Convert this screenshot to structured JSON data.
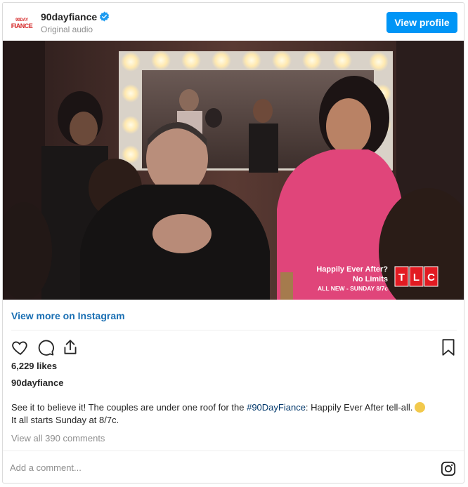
{
  "header": {
    "avatar_line1": "90DAY",
    "avatar_line2": "FIANCE",
    "username": "90dayfiance",
    "subtitle": "Original audio",
    "view_profile_label": "View profile"
  },
  "media": {
    "overlay_line1": "Happily Ever After?",
    "overlay_line2": "No Limits",
    "overlay_line3": "ALL NEW - SUNDAY 8/7c",
    "network_logo": "TLC"
  },
  "view_more_label": "View more on Instagram",
  "icons": {
    "like": "heart-icon",
    "comment": "comment-icon",
    "share": "share-icon",
    "save": "bookmark-icon",
    "instagram": "instagram-icon"
  },
  "likes_text": "6,229 likes",
  "owner_username": "90dayfiance",
  "caption": {
    "before_tag": "See it to believe it! The couples are under one roof for the ",
    "hashtag": "#90DayFiance",
    "after_tag": ": Happily Ever After tell-all.",
    "line2": "It all starts Sunday at 8/7c."
  },
  "comments_link": "View all 390 comments",
  "comment_input": {
    "placeholder": "Add a comment..."
  },
  "colors": {
    "accent": "#0095f6",
    "tlc_red": "#e21b22",
    "link_blue": "#1a6fb3"
  }
}
